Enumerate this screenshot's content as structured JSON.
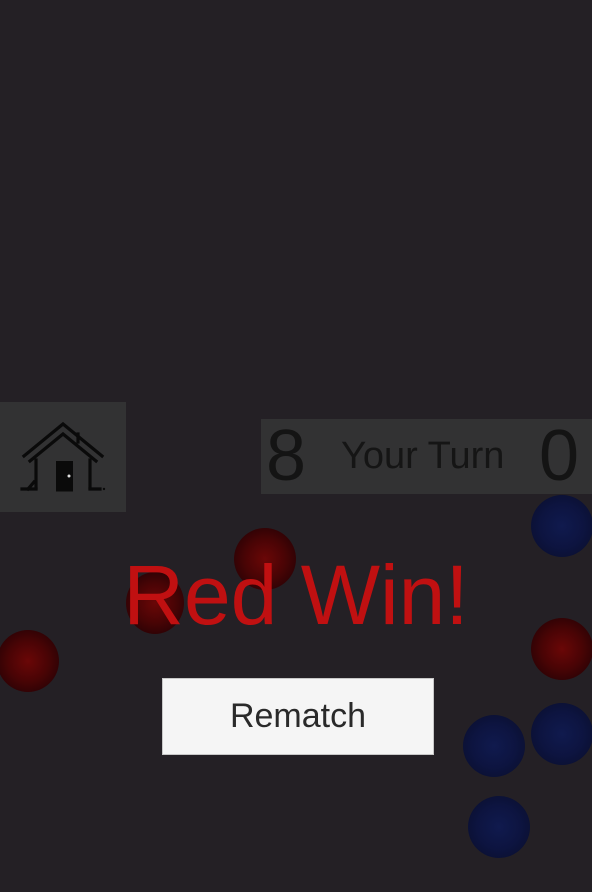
{
  "scoreboard": {
    "red_score": "8",
    "turn_label": "Your Turn",
    "blue_score": "0"
  },
  "result": {
    "message": "Red Win!"
  },
  "actions": {
    "rematch_label": "Rematch"
  },
  "icons": {
    "home": "home-icon"
  },
  "colors": {
    "background": "#242025",
    "panel": "#323233",
    "win_text": "#c01011",
    "red_ball": "#4a0405",
    "blue_ball": "#0d1440",
    "button_bg": "#f5f5f5"
  }
}
